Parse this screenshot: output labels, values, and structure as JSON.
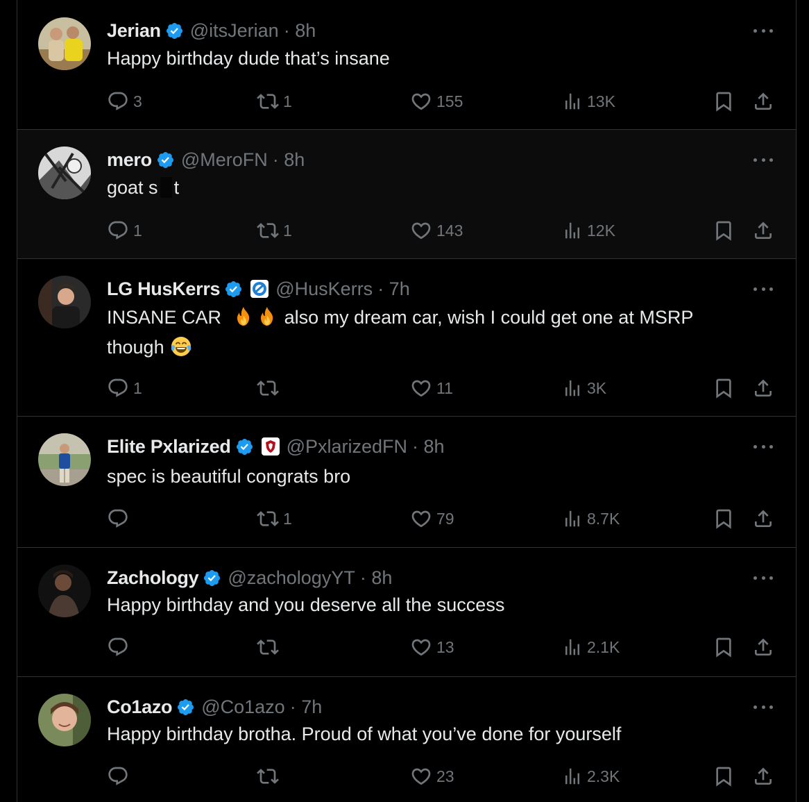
{
  "colors": {
    "background": "#000000",
    "text": "#e7e9ea",
    "muted": "#71767b",
    "verified": "#1d9bf0",
    "divider": "#2f3336"
  },
  "replies": [
    {
      "name": "Jerian",
      "handle": "@itsJerian",
      "time": "· 8h",
      "text": "Happy birthday dude that’s insane",
      "avatar": "avatar-photo-two-people",
      "replies": "3",
      "reposts": "1",
      "likes": "155",
      "views": "13K"
    },
    {
      "name": "mero",
      "handle": "@MeroFN",
      "time": "· 8h",
      "text_before": "goat s",
      "text_after": "t",
      "avatar": "avatar-anime-bw",
      "replies": "1",
      "reposts": "1",
      "likes": "143",
      "views": "12K"
    },
    {
      "name": "LG HusKerrs",
      "handle": "@HusKerrs",
      "time": "· 7h",
      "text_a": "INSANE CAR",
      "text_b": "also my dream car, wish I could get one at MSRP though",
      "emojis": [
        "fire-emoji",
        "fire-emoji",
        "tears-of-joy-emoji"
      ],
      "affiliate": "luminosity-badge-icon",
      "avatar": "avatar-photo-man",
      "replies": "1",
      "reposts": "",
      "likes": "11",
      "views": "3K"
    },
    {
      "name": "Elite Pxlarized",
      "handle": "@PxlarizedFN",
      "time": "· 8h",
      "text": "spec is beautiful congrats bro",
      "affiliate": "shield-badge-icon",
      "avatar": "avatar-photo-standing",
      "replies": "",
      "reposts": "1",
      "likes": "79",
      "views": "8.7K"
    },
    {
      "name": "Zachology",
      "handle": "@zachologyYT",
      "time": "· 8h",
      "text": "Happy birthday and you deserve all the success",
      "avatar": "avatar-photo-dark",
      "replies": "",
      "reposts": "",
      "likes": "13",
      "views": "2.1K"
    },
    {
      "name": "Co1azo",
      "handle": "@Co1azo",
      "time": "· 7h",
      "text": "Happy birthday brotha. Proud of what you’ve done for yourself",
      "avatar": "avatar-photo-smiling",
      "replies": "",
      "reposts": "",
      "likes": "23",
      "views": "2.3K"
    }
  ]
}
